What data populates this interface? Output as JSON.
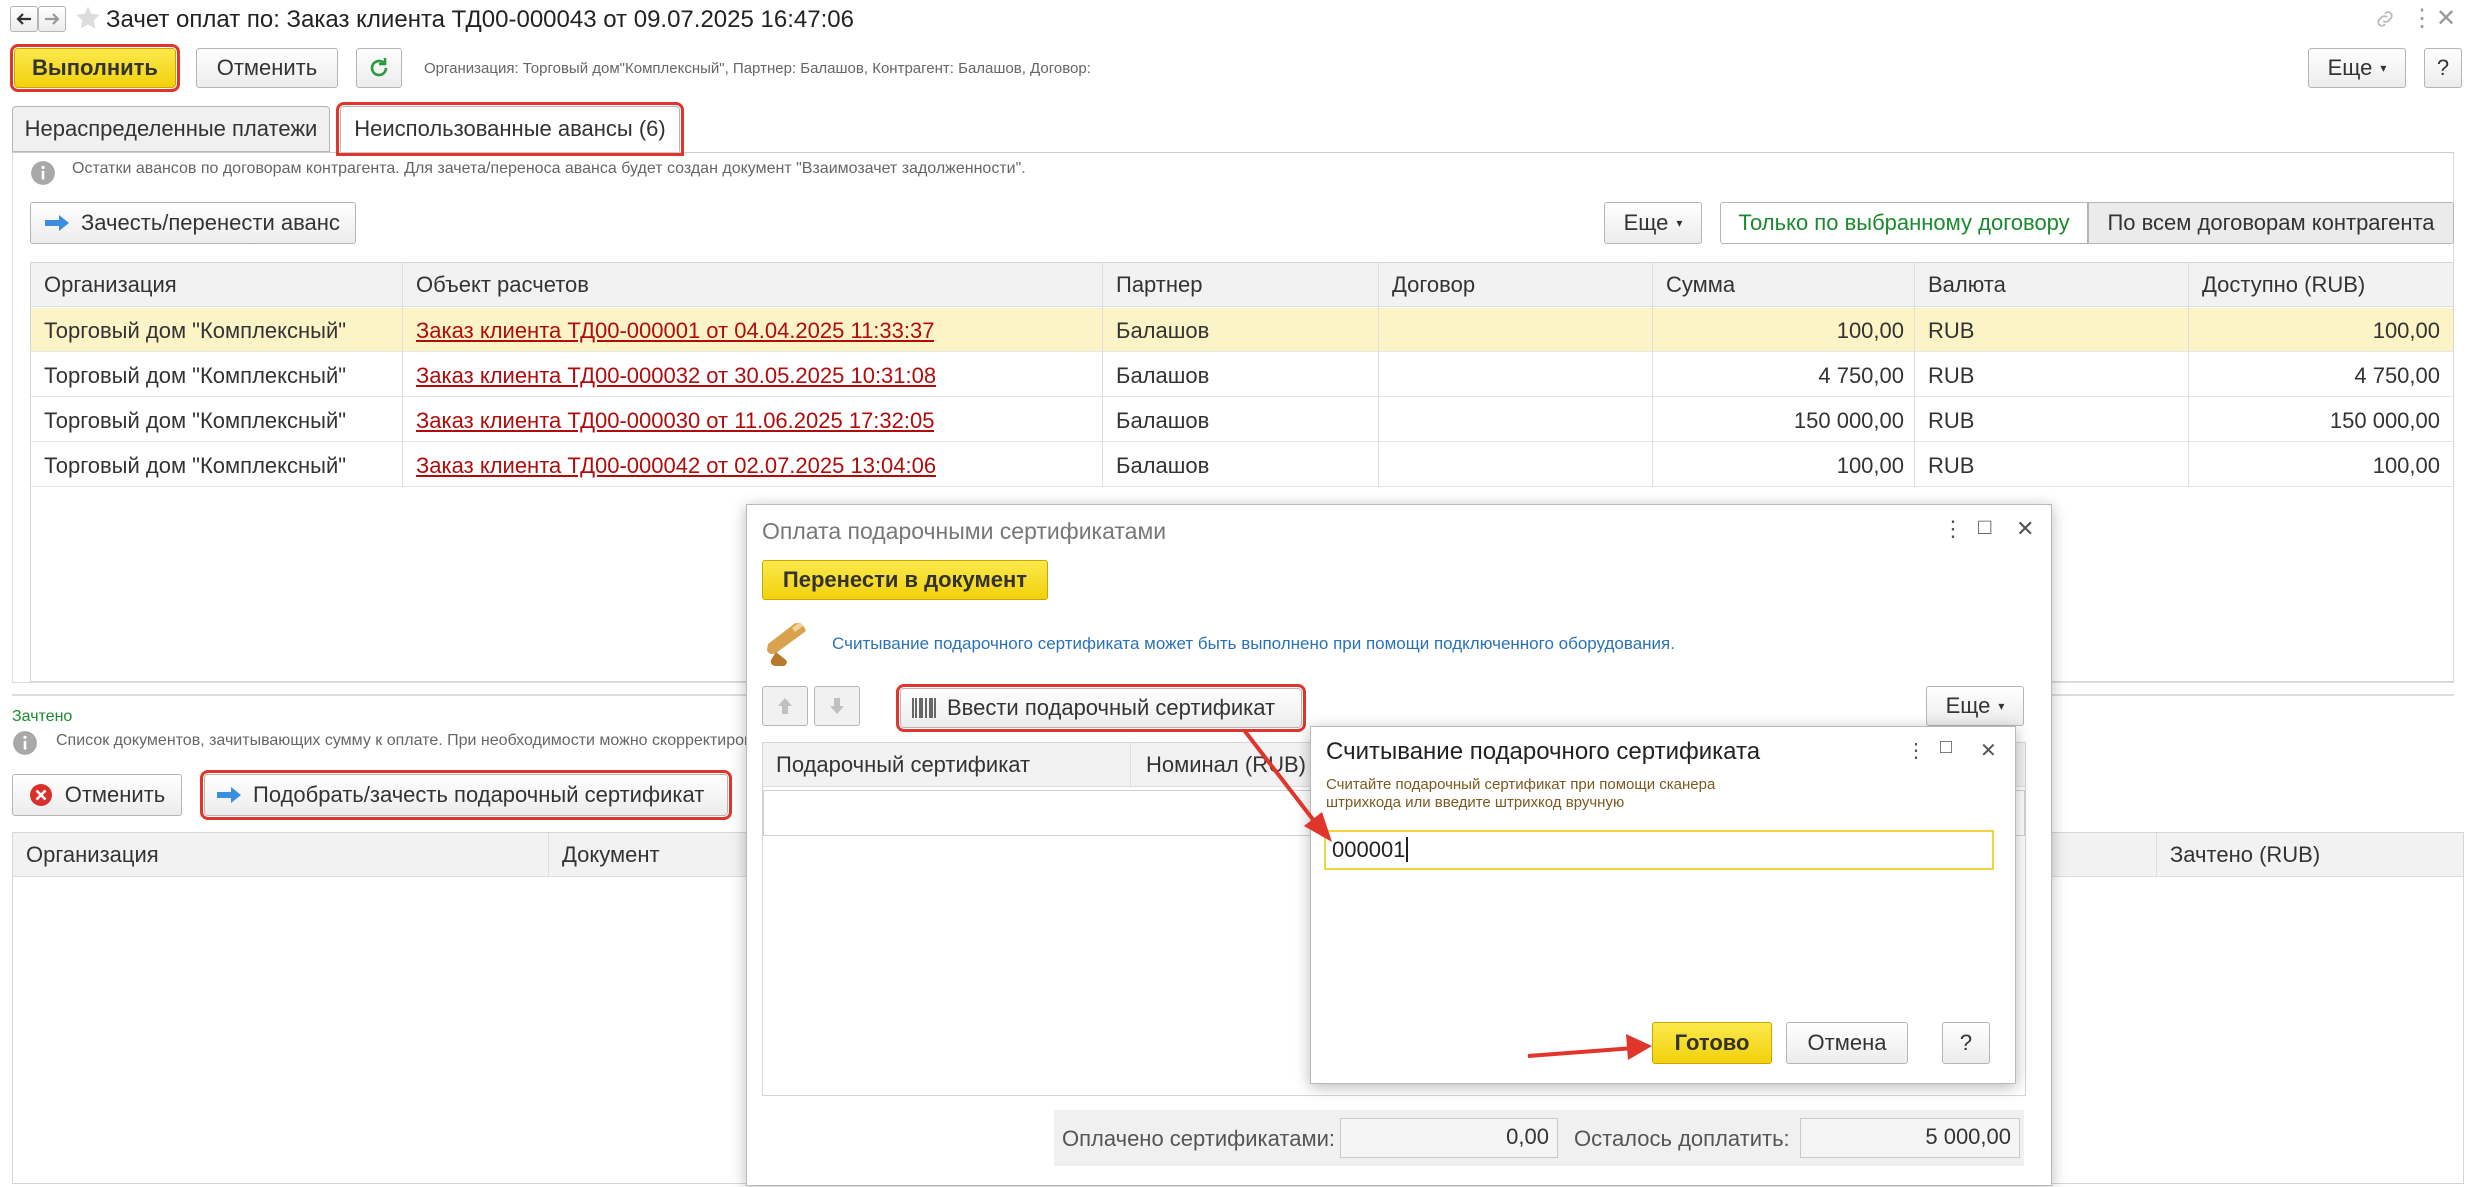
{
  "header": {
    "title": "Зачет оплат по: Заказ клиента ТД00-000043 от 09.07.2025 16:47:06",
    "execute_label": "Выполнить",
    "cancel_label": "Отменить",
    "info": "Организация: Торговый дом\"Комплексный\", Партнер: Балашов, Контрагент: Балашов, Договор:",
    "more_label": "Еще",
    "help_label": "?"
  },
  "tabs": [
    {
      "label": "Нераспределенные платежи"
    },
    {
      "label": "Неиспользованные авансы (6)"
    }
  ],
  "advances": {
    "info": "Остатки авансов по договорам контрагента. Для зачета/переноса аванса будет создан документ \"Взаимозачет задолженности\".",
    "offset_label": "Зачесть/перенести аванс",
    "more_label": "Еще",
    "only_selected_label": "Только по выбранному договору",
    "all_contracts_label": "По всем договорам контрагента",
    "columns": [
      "Организация",
      "Объект расчетов",
      "Партнер",
      "Договор",
      "Сумма",
      "Валюта",
      "Доступно (RUB)"
    ],
    "rows": [
      {
        "org": "Торговый дом \"Комплексный\"",
        "obj": "Заказ клиента ТД00-000001 от 04.04.2025 11:33:37",
        "partner": "Балашов",
        "contract": "",
        "sum": "100,00",
        "cur": "RUB",
        "avail": "100,00"
      },
      {
        "org": "Торговый дом \"Комплексный\"",
        "obj": "Заказ клиента ТД00-000032 от 30.05.2025 10:31:08",
        "partner": "Балашов",
        "contract": "",
        "sum": "4 750,00",
        "cur": "RUB",
        "avail": "4 750,00"
      },
      {
        "org": "Торговый дом \"Комплексный\"",
        "obj": "Заказ клиента ТД00-000030 от 11.06.2025 17:32:05",
        "partner": "Балашов",
        "contract": "",
        "sum": "150 000,00",
        "cur": "RUB",
        "avail": "150 000,00"
      },
      {
        "org": "Торговый дом \"Комплексный\"",
        "obj": "Заказ клиента ТД00-000042 от 02.07.2025 13:04:06",
        "partner": "Балашов",
        "contract": "",
        "sum": "100,00",
        "cur": "RUB",
        "avail": "100,00"
      }
    ]
  },
  "credited": {
    "title": "Зачтено",
    "info": "Список документов, зачитывающих сумму к оплате. При необходимости можно скорректировать",
    "cancel_label": "Отменить",
    "pick_cert_label": "Подобрать/зачесть подарочный сертификат",
    "col_org": "Организация",
    "col_doc": "Документ",
    "col_credited": "Зачтено (RUB)"
  },
  "gift_dialog": {
    "title": "Оплата подарочными сертификатами",
    "transfer_label": "Перенести в документ",
    "hint": "Считывание подарочного сертификата может быть выполнено при помощи подключенного оборудования.",
    "enter_cert_label": "Ввести подарочный сертификат",
    "more_label": "Еще",
    "col_cert": "Подарочный сертификат",
    "col_nominal": "Номинал (RUB)",
    "paid_label": "Оплачено сертификатами:",
    "paid_value": "0,00",
    "remaining_label": "Осталось доплатить:",
    "remaining_value": "5 000,00"
  },
  "scan_dialog": {
    "title": "Считывание подарочного сертификата",
    "hint": "Считайте подарочный сертификат при помощи сканера штрихкода или введите штрихкод вручную",
    "value": "000001",
    "done_label": "Готово",
    "cancel_label": "Отмена",
    "help_label": "?"
  },
  "colors": {
    "accent_yellow": "#f5d816",
    "link_red": "#b00c0c",
    "green": "#1a8a2e",
    "highlight": "#e0352b"
  }
}
